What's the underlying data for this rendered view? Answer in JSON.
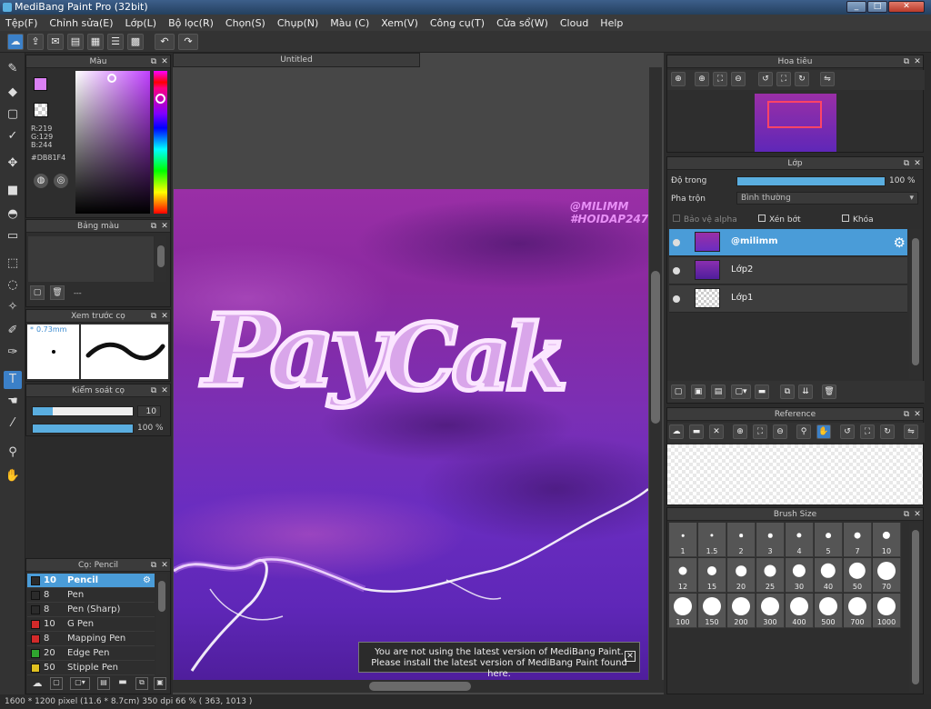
{
  "window": {
    "title": "MediBang Paint Pro (32bit)"
  },
  "menu": [
    "Tệp(F)",
    "Chỉnh sửa(E)",
    "Lớp(L)",
    "Bộ lọc(R)",
    "Chọn(S)",
    "Chụp(N)",
    "Màu (C)",
    "Xem(V)",
    "Công cụ(T)",
    "Cửa sổ(W)",
    "Cloud",
    "Help"
  ],
  "panels": {
    "color": {
      "title": "Màu",
      "r": "R:219",
      "g": "G:129",
      "b": "B:244",
      "hex": "#DB81F4",
      "current_color": "#db81f4"
    },
    "palette": {
      "title": "Bảng màu",
      "value": "---"
    },
    "brush_preview": {
      "title": "Xem trước cọ",
      "size": "0.73mm"
    },
    "brush_control": {
      "title": "Kiểm soát cọ",
      "size_value": "10",
      "opacity_value": "100 %",
      "size_fraction": 0.2,
      "opacity_fraction": 1.0
    },
    "brushes": {
      "title": "Cọ: Pencil",
      "items": [
        {
          "size": "10",
          "name": "Pencil",
          "color": "#2b2b2b"
        },
        {
          "size": "8",
          "name": "Pen",
          "color": "#2b2b2b"
        },
        {
          "size": "8",
          "name": "Pen (Sharp)",
          "color": "#2b2b2b"
        },
        {
          "size": "10",
          "name": "G Pen",
          "color": "#d22a2a"
        },
        {
          "size": "8",
          "name": "Mapping Pen",
          "color": "#d22a2a"
        },
        {
          "size": "20",
          "name": "Edge Pen",
          "color": "#2fa52f"
        },
        {
          "size": "50",
          "name": "Stipple Pen",
          "color": "#e0c020"
        }
      ]
    }
  },
  "document": {
    "tab": "Untitled",
    "watermark_line1": "@MILIMM",
    "watermark_line2": "#HOIDAP247",
    "art_text_1": "Pay",
    "art_text_2": "Cak"
  },
  "notice": {
    "line1": "You are not using the latest version of MediBang Paint.",
    "line2": "Please install the latest version of MediBang Paint found here.",
    "close": "✕"
  },
  "navigator": {
    "title": "Hoa tiêu"
  },
  "layers": {
    "title": "Lớp",
    "opacity_label": "Độ trong",
    "opacity_value": "100 %",
    "opacity_fraction": 1.0,
    "blend_label": "Pha trộn",
    "blend_value": "Bình thường",
    "protect_alpha": "Bảo vệ alpha",
    "clip": "Xén bớt",
    "lock": "Khóa",
    "items": [
      {
        "name": "@milimm"
      },
      {
        "name": "Lớp2"
      },
      {
        "name": "Lớp1"
      }
    ]
  },
  "reference": {
    "title": "Reference"
  },
  "brush_size": {
    "title": "Brush Size",
    "rows": [
      [
        "1",
        "1.5",
        "2",
        "3",
        "4",
        "5",
        "7",
        "10"
      ],
      [
        "12",
        "15",
        "20",
        "25",
        "30",
        "40",
        "50",
        "70"
      ],
      [
        "100",
        "150",
        "200",
        "300",
        "400",
        "500",
        "700",
        "1000"
      ]
    ]
  },
  "status": {
    "text": "1600 * 1200 pixel   (11.6 * 8.7cm)   350 dpi   66 %   ( 363, 1013 )"
  }
}
